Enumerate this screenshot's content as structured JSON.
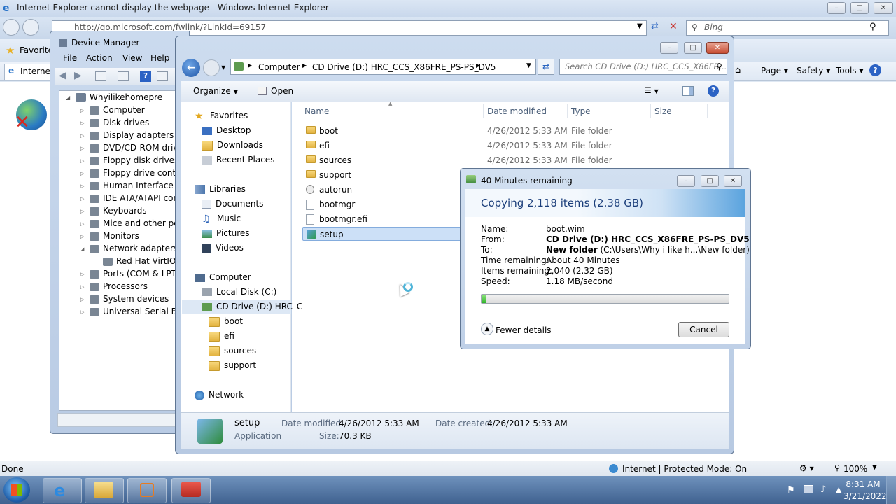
{
  "ie": {
    "title": "Internet Explorer cannot display the webpage - Windows Internet Explorer",
    "address": "http://go.microsoft.com/fwlink/?LinkId=69157",
    "search_placeholder": "Bing",
    "favorites": "Favorites",
    "tab": "Internet",
    "cmd_page": "Page",
    "cmd_safety": "Safety",
    "cmd_tools": "Tools",
    "status_done": "Done",
    "status_zone": "Internet | Protected Mode: On",
    "zoom": "100%"
  },
  "device_manager": {
    "title": "Device Manager",
    "menu": [
      "File",
      "Action",
      "View",
      "Help"
    ],
    "root": "Whyilikehomepre",
    "items": [
      "Computer",
      "Disk drives",
      "Display adapters",
      "DVD/CD-ROM drive",
      "Floppy disk drives",
      "Floppy drive contro",
      "Human Interface De",
      "IDE ATA/ATAPI con",
      "Keyboards",
      "Mice and other poir",
      "Monitors",
      "Network adapters",
      "Red Hat VirtIO E",
      "Ports (COM & LPT)",
      "Processors",
      "System devices",
      "Universal Serial Bus"
    ]
  },
  "explorer": {
    "breadcrumb": [
      "Computer",
      "CD Drive (D:) HRC_CCS_X86FRE_PS-PS_DV5"
    ],
    "search_placeholder": "Search CD Drive (D:) HRC_CCS_X86FR...",
    "organize": "Organize",
    "open": "Open",
    "nav": {
      "favorites": "Favorites",
      "desktop": "Desktop",
      "downloads": "Downloads",
      "recent": "Recent Places",
      "libraries": "Libraries",
      "documents": "Documents",
      "music": "Music",
      "pictures": "Pictures",
      "videos": "Videos",
      "computer": "Computer",
      "local_disk": "Local Disk (C:)",
      "cd_drive": "CD Drive (D:) HRC_C",
      "sub": [
        "boot",
        "efi",
        "sources",
        "support"
      ],
      "network": "Network"
    },
    "columns": {
      "name": "Name",
      "date": "Date modified",
      "type": "Type",
      "size": "Size"
    },
    "files": [
      {
        "name": "boot",
        "date": "4/26/2012 5:33 AM",
        "type": "File folder"
      },
      {
        "name": "efi",
        "date": "4/26/2012 5:33 AM",
        "type": "File folder"
      },
      {
        "name": "sources",
        "date": "4/26/2012 5:33 AM",
        "type": "File folder"
      },
      {
        "name": "support",
        "date": "",
        "type": ""
      },
      {
        "name": "autorun",
        "date": "",
        "type": ""
      },
      {
        "name": "bootmgr",
        "date": "",
        "type": ""
      },
      {
        "name": "bootmgr.efi",
        "date": "",
        "type": ""
      },
      {
        "name": "setup",
        "date": "",
        "type": ""
      }
    ],
    "details": {
      "name": "setup",
      "kind": "Application",
      "modified_label": "Date modified:",
      "modified": "4/26/2012 5:33 AM",
      "created_label": "Date created:",
      "created": "4/26/2012 5:33 AM",
      "size_label": "Size:",
      "size": "70.3 KB"
    }
  },
  "copy_dialog": {
    "title": "40 Minutes remaining",
    "heading": "Copying 2,118 items (2.38 GB)",
    "labels": {
      "name": "Name:",
      "from": "From:",
      "to": "To:",
      "time": "Time remaining:",
      "items": "Items remaining:",
      "speed": "Speed:"
    },
    "name": "boot.wim",
    "from": "CD Drive (D:) HRC_CCS_X86FRE_PS-PS_DV5",
    "to_bold": "New folder",
    "to_path": "(C:\\Users\\Why i like h...\\New folder)",
    "time": "About 40 Minutes",
    "items": "2,040 (2.32 GB)",
    "speed": "1.18 MB/second",
    "progress_pct": 2,
    "fewer": "Fewer details",
    "cancel": "Cancel"
  },
  "taskbar": {
    "time": "8:31 AM",
    "date": "3/21/2022"
  }
}
